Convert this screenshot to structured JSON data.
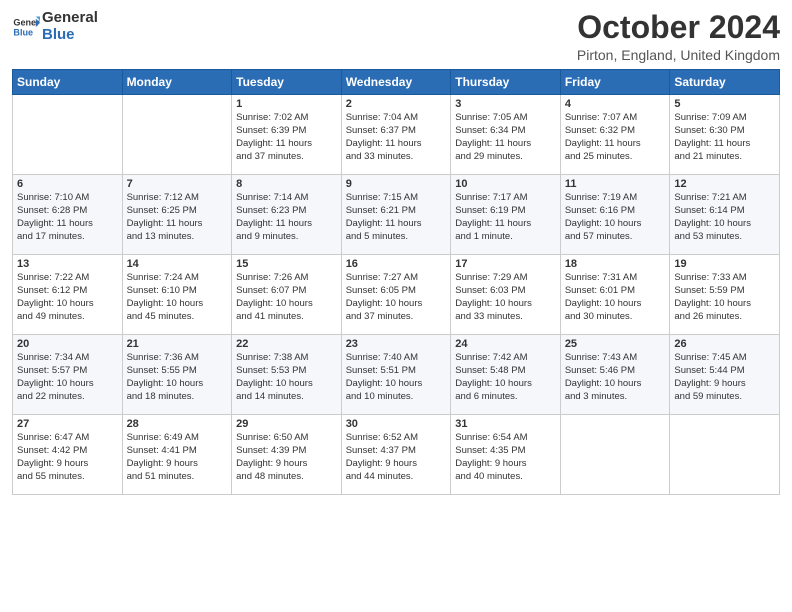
{
  "header": {
    "logo_general": "General",
    "logo_blue": "Blue",
    "month_title": "October 2024",
    "location": "Pirton, England, United Kingdom"
  },
  "days_of_week": [
    "Sunday",
    "Monday",
    "Tuesday",
    "Wednesday",
    "Thursday",
    "Friday",
    "Saturday"
  ],
  "weeks": [
    [
      {
        "day": "",
        "content": ""
      },
      {
        "day": "",
        "content": ""
      },
      {
        "day": "1",
        "content": "Sunrise: 7:02 AM\nSunset: 6:39 PM\nDaylight: 11 hours\nand 37 minutes."
      },
      {
        "day": "2",
        "content": "Sunrise: 7:04 AM\nSunset: 6:37 PM\nDaylight: 11 hours\nand 33 minutes."
      },
      {
        "day": "3",
        "content": "Sunrise: 7:05 AM\nSunset: 6:34 PM\nDaylight: 11 hours\nand 29 minutes."
      },
      {
        "day": "4",
        "content": "Sunrise: 7:07 AM\nSunset: 6:32 PM\nDaylight: 11 hours\nand 25 minutes."
      },
      {
        "day": "5",
        "content": "Sunrise: 7:09 AM\nSunset: 6:30 PM\nDaylight: 11 hours\nand 21 minutes."
      }
    ],
    [
      {
        "day": "6",
        "content": "Sunrise: 7:10 AM\nSunset: 6:28 PM\nDaylight: 11 hours\nand 17 minutes."
      },
      {
        "day": "7",
        "content": "Sunrise: 7:12 AM\nSunset: 6:25 PM\nDaylight: 11 hours\nand 13 minutes."
      },
      {
        "day": "8",
        "content": "Sunrise: 7:14 AM\nSunset: 6:23 PM\nDaylight: 11 hours\nand 9 minutes."
      },
      {
        "day": "9",
        "content": "Sunrise: 7:15 AM\nSunset: 6:21 PM\nDaylight: 11 hours\nand 5 minutes."
      },
      {
        "day": "10",
        "content": "Sunrise: 7:17 AM\nSunset: 6:19 PM\nDaylight: 11 hours\nand 1 minute."
      },
      {
        "day": "11",
        "content": "Sunrise: 7:19 AM\nSunset: 6:16 PM\nDaylight: 10 hours\nand 57 minutes."
      },
      {
        "day": "12",
        "content": "Sunrise: 7:21 AM\nSunset: 6:14 PM\nDaylight: 10 hours\nand 53 minutes."
      }
    ],
    [
      {
        "day": "13",
        "content": "Sunrise: 7:22 AM\nSunset: 6:12 PM\nDaylight: 10 hours\nand 49 minutes."
      },
      {
        "day": "14",
        "content": "Sunrise: 7:24 AM\nSunset: 6:10 PM\nDaylight: 10 hours\nand 45 minutes."
      },
      {
        "day": "15",
        "content": "Sunrise: 7:26 AM\nSunset: 6:07 PM\nDaylight: 10 hours\nand 41 minutes."
      },
      {
        "day": "16",
        "content": "Sunrise: 7:27 AM\nSunset: 6:05 PM\nDaylight: 10 hours\nand 37 minutes."
      },
      {
        "day": "17",
        "content": "Sunrise: 7:29 AM\nSunset: 6:03 PM\nDaylight: 10 hours\nand 33 minutes."
      },
      {
        "day": "18",
        "content": "Sunrise: 7:31 AM\nSunset: 6:01 PM\nDaylight: 10 hours\nand 30 minutes."
      },
      {
        "day": "19",
        "content": "Sunrise: 7:33 AM\nSunset: 5:59 PM\nDaylight: 10 hours\nand 26 minutes."
      }
    ],
    [
      {
        "day": "20",
        "content": "Sunrise: 7:34 AM\nSunset: 5:57 PM\nDaylight: 10 hours\nand 22 minutes."
      },
      {
        "day": "21",
        "content": "Sunrise: 7:36 AM\nSunset: 5:55 PM\nDaylight: 10 hours\nand 18 minutes."
      },
      {
        "day": "22",
        "content": "Sunrise: 7:38 AM\nSunset: 5:53 PM\nDaylight: 10 hours\nand 14 minutes."
      },
      {
        "day": "23",
        "content": "Sunrise: 7:40 AM\nSunset: 5:51 PM\nDaylight: 10 hours\nand 10 minutes."
      },
      {
        "day": "24",
        "content": "Sunrise: 7:42 AM\nSunset: 5:48 PM\nDaylight: 10 hours\nand 6 minutes."
      },
      {
        "day": "25",
        "content": "Sunrise: 7:43 AM\nSunset: 5:46 PM\nDaylight: 10 hours\nand 3 minutes."
      },
      {
        "day": "26",
        "content": "Sunrise: 7:45 AM\nSunset: 5:44 PM\nDaylight: 9 hours\nand 59 minutes."
      }
    ],
    [
      {
        "day": "27",
        "content": "Sunrise: 6:47 AM\nSunset: 4:42 PM\nDaylight: 9 hours\nand 55 minutes."
      },
      {
        "day": "28",
        "content": "Sunrise: 6:49 AM\nSunset: 4:41 PM\nDaylight: 9 hours\nand 51 minutes."
      },
      {
        "day": "29",
        "content": "Sunrise: 6:50 AM\nSunset: 4:39 PM\nDaylight: 9 hours\nand 48 minutes."
      },
      {
        "day": "30",
        "content": "Sunrise: 6:52 AM\nSunset: 4:37 PM\nDaylight: 9 hours\nand 44 minutes."
      },
      {
        "day": "31",
        "content": "Sunrise: 6:54 AM\nSunset: 4:35 PM\nDaylight: 9 hours\nand 40 minutes."
      },
      {
        "day": "",
        "content": ""
      },
      {
        "day": "",
        "content": ""
      }
    ]
  ]
}
